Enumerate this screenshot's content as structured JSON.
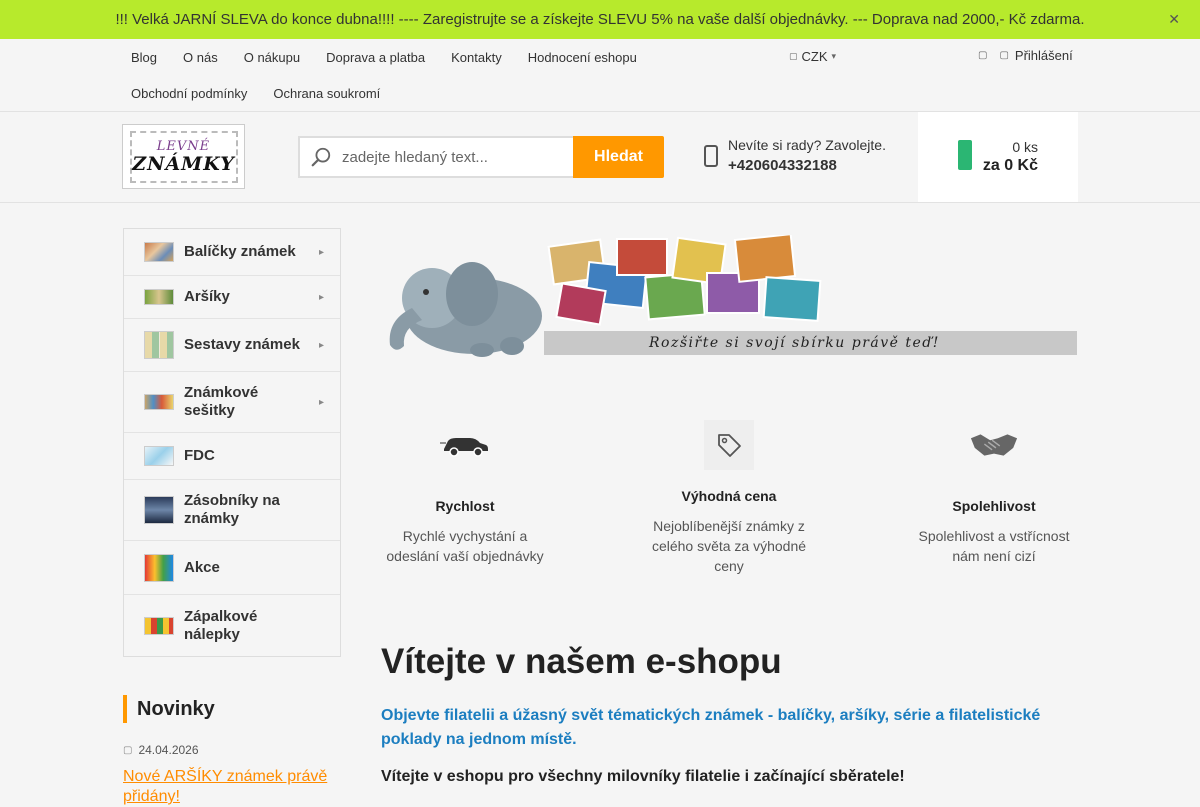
{
  "promo": {
    "text": "!!! Velká JARNÍ SLEVA do konce dubna!!!! ---- Zaregistrujte se a získejte SLEVU 5% na vaše další objednávky. --- Doprava nad 2000,- Kč zdarma.",
    "close_icon": "close-icon"
  },
  "topnav": {
    "links_row1": [
      "Blog",
      "O nás",
      "O nákupu",
      "Doprava a platba",
      "Kontakty",
      "Hodnocení eshopu"
    ],
    "links_row2": [
      "Obchodní podmínky",
      "Ochrana soukromí"
    ],
    "currency": "CZK",
    "login": "Přihlášení"
  },
  "header": {
    "logo_line1": "LEVNÉ",
    "logo_line2": "ZNÁMKY",
    "search_placeholder": "zadejte hledaný text...",
    "search_button": "Hledat",
    "help_text": "Nevíte si rady? Zavolejte.",
    "phone": "+420604332188",
    "cart_qty": "0 ks",
    "cart_price": "za 0 Kč"
  },
  "categories": [
    {
      "label": "Balíčky známek"
    },
    {
      "label": "Aršíky"
    },
    {
      "label": "Sestavy známek"
    },
    {
      "label": "Známkové sešitky"
    },
    {
      "label": "FDC"
    },
    {
      "label": "Zásobníky na známky"
    },
    {
      "label": "Akce"
    },
    {
      "label": "Zápalkové nálepky"
    }
  ],
  "news": {
    "title": "Novinky",
    "date": "24.04.2026",
    "link": "Nové ARŠÍKY známek právě přidány!"
  },
  "banner": {
    "slogan": "Rozšiřte si svojí sbírku právě teď!"
  },
  "benefits": [
    {
      "title": "Rychlost",
      "desc": "Rychlé vychystání a odeslání vaší objednávky",
      "icon": "car-icon"
    },
    {
      "title": "Výhodná cena",
      "desc": "Nejoblíbenější známky z celého světa za výhodné ceny",
      "icon": "price-tag-icon"
    },
    {
      "title": "Spolehlivost",
      "desc": "Spolehlivost a vstřícnost nám není cizí",
      "icon": "handshake-icon"
    }
  ],
  "welcome": {
    "heading": "Vítejte v našem e-shopu",
    "lead": "Objevte filatelii a úžasný svět tématických známek - balíčky, aršíky, série a filatelistické poklady na jednom místě.",
    "sub": "Vítejte v eshopu pro všechny milovníky filatelie i začínající sběratele!"
  },
  "colors": {
    "promo_bg": "#b7ea2c",
    "accent": "#ff9800",
    "cart_icon": "#2bb673",
    "lead_blue": "#1c7ec0"
  }
}
